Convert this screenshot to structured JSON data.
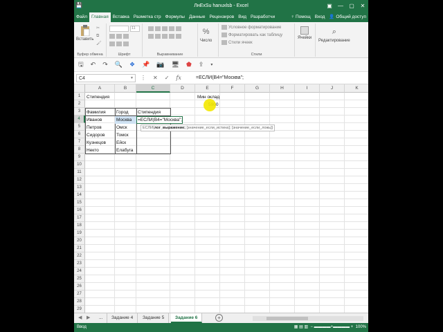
{
  "window": {
    "title": "ЛнЕхSu hanuxlsb - Excel",
    "controls": [
      "—",
      "▢",
      "✕"
    ]
  },
  "ribbon_tabs": [
    "Файл",
    "Главная",
    "Вставка",
    "Разметка стр",
    "Формулы",
    "Данные",
    "Рецензиров",
    "Вид",
    "Разработчи"
  ],
  "ribbon_tabs_right": [
    "♀ Помощ",
    "Вход",
    "Общий доступ"
  ],
  "ribbon": {
    "paste_label": "Вставить",
    "clipboard_group": "Буфер обмена",
    "font_group": "Шрифт",
    "font_size": "11",
    "align_group": "Выравнивание",
    "number_label": "Число",
    "cond_format": "Условное форматирование",
    "format_table": "Форматировать как таблицу",
    "cell_styles": "Стили ячеек",
    "styles_group": "Стили",
    "cells_label": "Ячейки",
    "editing_label": "Редактирование"
  },
  "formula_bar": {
    "name_box": "C4",
    "formula": "=ЕСЛИ(B4=\"Москва\";"
  },
  "columns": [
    "A",
    "B",
    "C",
    "D",
    "E",
    "F",
    "G",
    "H",
    "I",
    "J",
    "K"
  ],
  "rows": [
    "1",
    "2",
    "3",
    "4",
    "5",
    "6",
    "7",
    "8",
    "9",
    "10",
    "11",
    "12",
    "13",
    "14",
    "15",
    "16",
    "17",
    "18",
    "19",
    "20",
    "21",
    "22",
    "23",
    "24",
    "25",
    "26",
    "27",
    "28",
    "29"
  ],
  "cells": {
    "a1": "Стипендия",
    "e1": "Мин оклад",
    "e2": "5900",
    "a3": "Фамилия",
    "b3": "Город",
    "c3": "Стипендия",
    "a4": "Иванов",
    "b4": "Москва",
    "c4": "=ЕСЛИ(B4=\"Москва\";",
    "a5": "Петров",
    "b5": "Омск",
    "a6": "Сидоров",
    "b6": "Томск",
    "a7": "Кузнецов",
    "b7": "Ейск",
    "a8": "Некто",
    "b8": "Елабуга"
  },
  "tooltip": {
    "fn": "ЕСЛИ(",
    "arg1": "лог_выражение;",
    "arg2": "[значение_если_истина];",
    "arg3": "[значение_если_ложь])"
  },
  "sheets": {
    "overflow": "...",
    "tabs": [
      "Задание 4",
      "Задание 5",
      "Задание 6"
    ],
    "active_index": 2
  },
  "status": {
    "mode": "Ввод",
    "zoom": "100%"
  },
  "colors": {
    "excel_green": "#217346",
    "highlight": "#f3e800"
  }
}
